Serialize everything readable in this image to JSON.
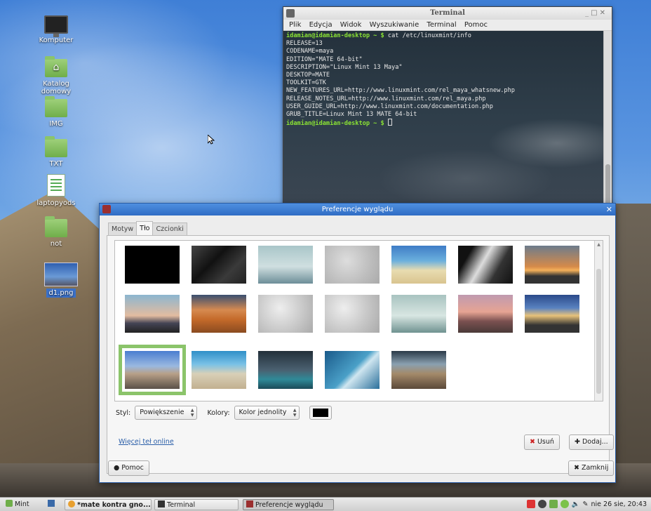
{
  "desktop": {
    "icons": [
      {
        "label": "Komputer"
      },
      {
        "label": "Katalog domowy"
      },
      {
        "label": "IMG"
      },
      {
        "label": "TXT"
      },
      {
        "label": "laptopyods"
      },
      {
        "label": "not"
      },
      {
        "label": "d1.png"
      }
    ]
  },
  "terminal": {
    "title": "Terminal",
    "menu": [
      "Plik",
      "Edycja",
      "Widok",
      "Wyszukiwanie",
      "Terminal",
      "Pomoc"
    ],
    "prompt": "idamian@idamian-desktop ~ $",
    "command": "cat /etc/linuxmint/info",
    "output": [
      "RELEASE=13",
      "CODENAME=maya",
      "EDITION=\"MATE 64-bit\"",
      "DESCRIPTION=\"Linux Mint 13 Maya\"",
      "DESKTOP=MATE",
      "TOOLKIT=GTK",
      "NEW_FEATURES_URL=http://www.linuxmint.com/rel_maya_whatsnew.php",
      "RELEASE_NOTES_URL=http://www.linuxmint.com/rel_maya.php",
      "USER_GUIDE_URL=http://www.linuxmint.com/documentation.php",
      "GRUB_TITLE=Linux Mint 13 MATE 64-bit"
    ]
  },
  "dialog": {
    "title": "Preferencje wyglądu",
    "tabs": [
      "Motyw",
      "Tło",
      "Czcionki"
    ],
    "style_label": "Styl:",
    "style_value": "Powiększenie",
    "colors_label": "Kolory:",
    "colors_value": "Kolor jednolity",
    "color_swatch": "#000000",
    "online_link": "Więcej teł online",
    "remove_button": "Usuń",
    "add_button": "Dodaj...",
    "help_button": "Pomoc",
    "close_button": "Zamknij",
    "wallpapers_count": 19,
    "selected_wallpaper_index": 15
  },
  "taskbar": {
    "menu_label": "Mint",
    "items": [
      "*mate kontra gno...",
      "Terminal",
      "Preferencje wyglądu"
    ],
    "clock": "nie 26 sie, 20:43"
  },
  "colors": {
    "accent": "#2f6cc4",
    "prompt_green": "#8ae234",
    "selection_green": "#8bc46a"
  }
}
